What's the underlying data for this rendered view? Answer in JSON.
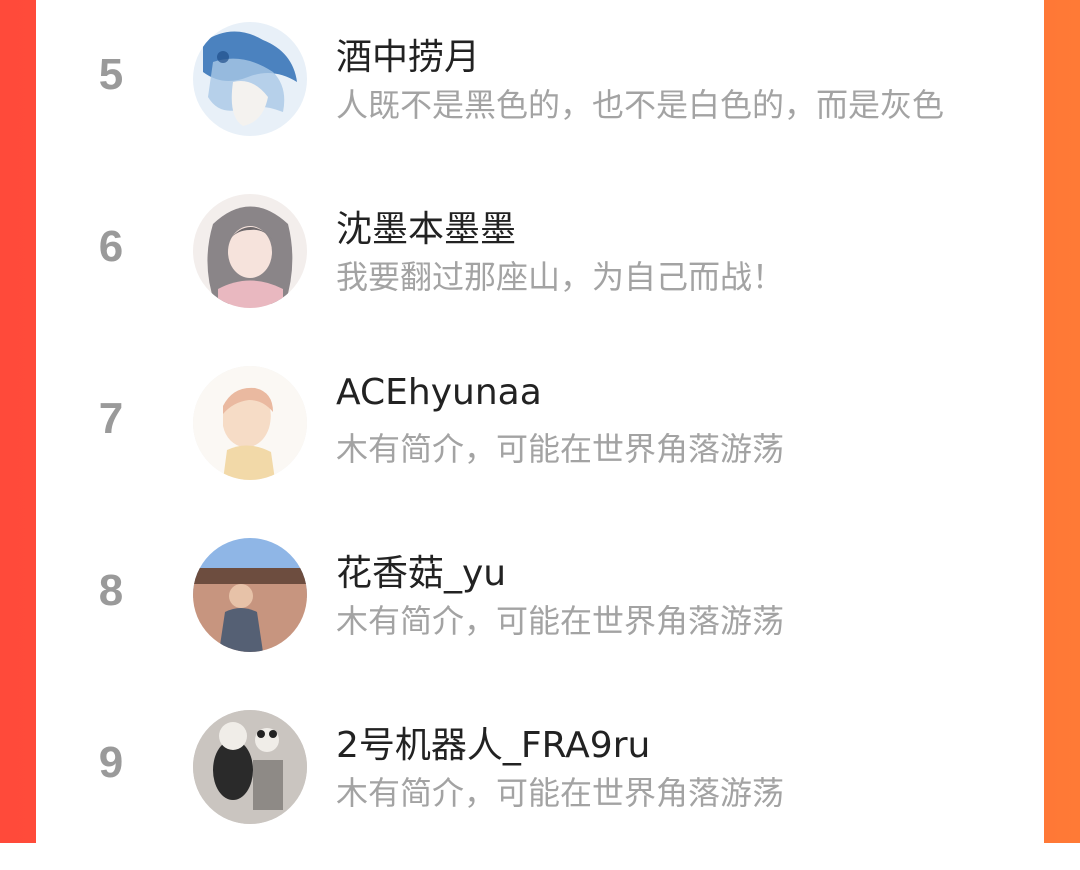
{
  "colors": {
    "frame_left": "#ff4a3a",
    "frame_right": "#ff7a36",
    "card": "#ffffff",
    "rank": "#9a9a9a",
    "name": "#222222",
    "bio": "#a3a3a3"
  },
  "ranking": {
    "items": [
      {
        "rank": "5",
        "name": "酒中捞月",
        "bio": "人既不是黑色的，也不是白色的，而是灰色"
      },
      {
        "rank": "6",
        "name": "沈墨本墨墨",
        "bio": "我要翻过那座山，为自己而战！"
      },
      {
        "rank": "7",
        "name": "ACEhyunaa",
        "bio": "木有简介，可能在世界角落游荡"
      },
      {
        "rank": "8",
        "name": "花香菇_yu",
        "bio": "木有简介，可能在世界角落游荡"
      },
      {
        "rank": "9",
        "name": "2号机器人_FRA9ru",
        "bio": "木有简介，可能在世界角落游荡"
      }
    ]
  }
}
